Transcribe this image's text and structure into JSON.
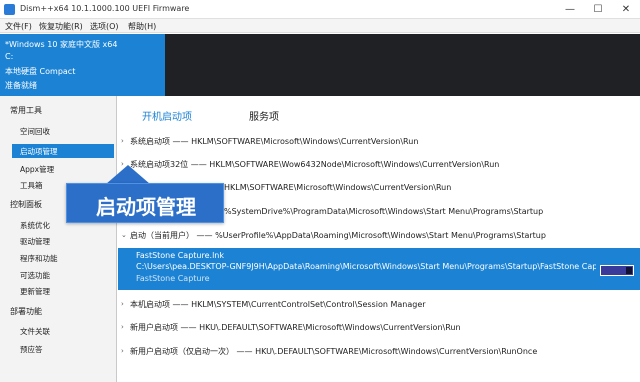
{
  "window": {
    "title": "Dism++x64 10.1.1000.100 UEFI Firmware",
    "min_glyph": "—",
    "max_glyph": "☐",
    "close_glyph": "✕"
  },
  "menu": [
    "文件(F)",
    "恢复功能(R)",
    "选项(O)",
    "帮助(H)"
  ],
  "info": {
    "line1": "*Windows 10 家庭中文版 x64",
    "line2": "C:",
    "line3": "本地硬盘 Compact",
    "line4": "准备就绪"
  },
  "sidebar": {
    "sections": [
      {
        "title": "常用工具",
        "items": [
          "空间回收",
          "启动项管理",
          "Appx管理",
          "工具箱"
        ]
      },
      {
        "title": "控制面板",
        "items": [
          "系统优化",
          "驱动管理",
          "程序和功能",
          "可选功能",
          "更新管理"
        ]
      },
      {
        "title": "部署功能",
        "items": [
          "文件关联",
          "预应答"
        ]
      }
    ],
    "selected": "启动项管理"
  },
  "callout": {
    "text": "启动项管理"
  },
  "tabs": {
    "active": "开机启动项",
    "inactive": "服务项"
  },
  "rows": [
    "系统启动项 —— HKLM\\SOFTWARE\\Microsoft\\Windows\\CurrentVersion\\Run",
    "系统启动项32位 —— HKLM\\SOFTWARE\\Wow6432Node\\Microsoft\\Windows\\CurrentVersion\\Run",
    "HKLM\\SOFTWARE\\Microsoft\\Windows\\CurrentVersion\\Run",
    "%SystemDrive%\\ProgramData\\Microsoft\\Windows\\Start Menu\\Programs\\Startup",
    "启动（当前用户） —— %UserProfile%\\AppData\\Roaming\\Microsoft\\Windows\\Start Menu\\Programs\\Startup"
  ],
  "selected_entry": {
    "name": "FastStone Capture.lnk",
    "path": "C:\\Users\\pea.DESKTOP-GNF9J9H\\AppData\\Roaming\\Microsoft\\Windows\\Start Menu\\Programs\\Startup\\FastStone Captu",
    "description": "FastStone Capture",
    "enabled": true
  },
  "rows_after": [
    "本机启动项 —— HKLM\\SYSTEM\\CurrentControlSet\\Control\\Session Manager",
    "新用户启动项 —— HKU\\.DEFAULT\\SOFTWARE\\Microsoft\\Windows\\CurrentVersion\\Run",
    "新用户启动项（仅启动一次） —— HKU\\.DEFAULT\\SOFTWARE\\Microsoft\\Windows\\CurrentVersion\\RunOnce"
  ],
  "colors": {
    "accent": "#1c83d4",
    "dark": "#1f2124",
    "callout": "#2c6fc9"
  }
}
